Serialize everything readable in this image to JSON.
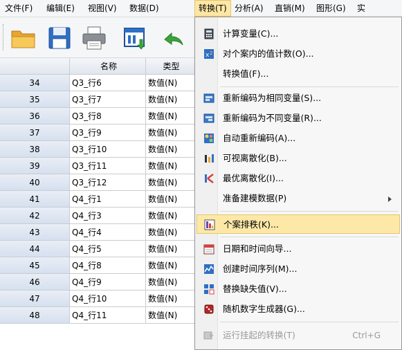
{
  "menubar": {
    "items": [
      {
        "label": "文件(F)"
      },
      {
        "label": "编辑(E)"
      },
      {
        "label": "视图(V)"
      },
      {
        "label": "数据(D)"
      },
      {
        "label": "转换(T)"
      },
      {
        "label": "分析(A)"
      },
      {
        "label": "直销(M)"
      },
      {
        "label": "图形(G)"
      },
      {
        "label": "实"
      }
    ]
  },
  "toolbar": {
    "buttons": [
      {
        "icon": "open-folder-icon"
      },
      {
        "icon": "save-icon"
      },
      {
        "icon": "print-icon"
      },
      {
        "icon": "dialog-recall-icon"
      },
      {
        "icon": "undo-icon"
      }
    ]
  },
  "grid": {
    "headers": [
      "",
      "名称",
      "类型"
    ],
    "rows": [
      {
        "num": "34",
        "name": "Q3_行6",
        "type": "数值(N)"
      },
      {
        "num": "35",
        "name": "Q3_行7",
        "type": "数值(N)"
      },
      {
        "num": "36",
        "name": "Q3_行8",
        "type": "数值(N)"
      },
      {
        "num": "37",
        "name": "Q3_行9",
        "type": "数值(N)"
      },
      {
        "num": "38",
        "name": "Q3_行10",
        "type": "数值(N)"
      },
      {
        "num": "39",
        "name": "Q3_行11",
        "type": "数值(N)"
      },
      {
        "num": "40",
        "name": "Q3_行12",
        "type": "数值(N)"
      },
      {
        "num": "41",
        "name": "Q4_行1",
        "type": "数值(N)"
      },
      {
        "num": "42",
        "name": "Q4_行3",
        "type": "数值(N)"
      },
      {
        "num": "43",
        "name": "Q4_行4",
        "type": "数值(N)"
      },
      {
        "num": "44",
        "name": "Q4_行5",
        "type": "数值(N)"
      },
      {
        "num": "45",
        "name": "Q4_行8",
        "type": "数值(N)"
      },
      {
        "num": "46",
        "name": "Q4_行9",
        "type": "数值(N)"
      },
      {
        "num": "47",
        "name": "Q4_行10",
        "type": "数值(N)"
      },
      {
        "num": "48",
        "name": "Q4_行11",
        "type": "数值(N)"
      }
    ]
  },
  "transform_menu": {
    "items": [
      {
        "label": "计算变量(C)...",
        "icon": "calculator-icon"
      },
      {
        "label": "对个案内的值计数(O)...",
        "icon": "count-values-icon"
      },
      {
        "label": "转换值(F)...",
        "icon": ""
      },
      {
        "label": "重新编码为相同变量(S)...",
        "icon": "recode-same-icon"
      },
      {
        "label": "重新编码为不同变量(R)...",
        "icon": "recode-different-icon"
      },
      {
        "label": "自动重新编码(A)...",
        "icon": "auto-recode-icon"
      },
      {
        "label": "可视离散化(B)...",
        "icon": "visual-binning-icon"
      },
      {
        "label": "最优离散化(I)...",
        "icon": "optimal-binning-icon"
      },
      {
        "label": "准备建模数据(P)",
        "icon": "",
        "submenu": true
      },
      {
        "label": "个案排秩(K)...",
        "icon": "rank-cases-icon",
        "highlighted": true
      },
      {
        "label": "日期和时间向导...",
        "icon": "calendar-icon"
      },
      {
        "label": "创建时间序列(M)...",
        "icon": "time-series-icon"
      },
      {
        "label": "替换缺失值(V)...",
        "icon": "replace-missing-icon"
      },
      {
        "label": "随机数字生成器(G)...",
        "icon": "dice-icon"
      },
      {
        "label": "运行挂起的转换(T)",
        "icon": "run-pending-icon",
        "shortcut": "Ctrl+G",
        "disabled": true
      }
    ]
  },
  "colors": {
    "highlight_bg": "#fde8a8",
    "highlight_border": "#e6c76a",
    "row_header_bg": "#dbe4f1",
    "disabled_text": "#9a9a9a"
  }
}
